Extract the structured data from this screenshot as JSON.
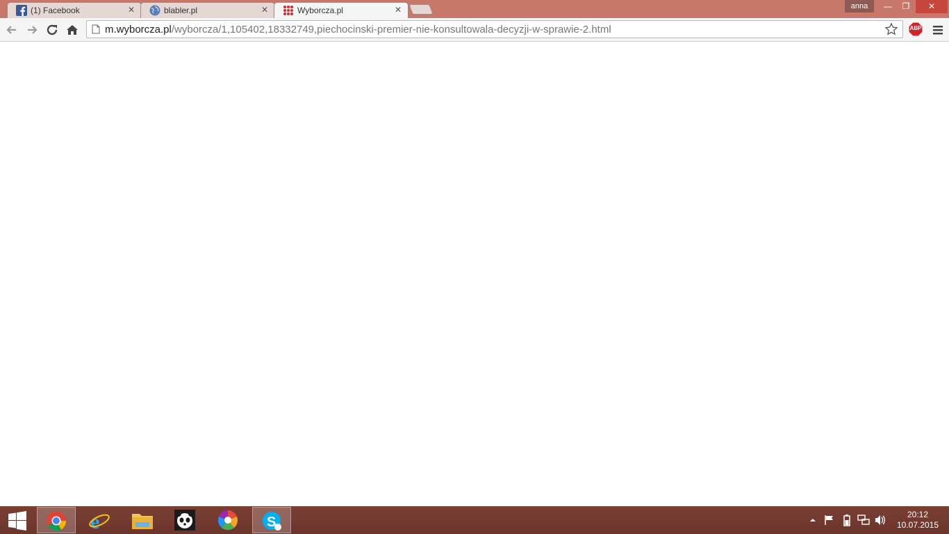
{
  "browser": {
    "tabs": [
      {
        "title": "(1) Facebook",
        "icon": "facebook-icon"
      },
      {
        "title": "blabler.pl",
        "icon": "globe-icon"
      },
      {
        "title": "Wyborcza.pl",
        "icon": "wyborcza-icon",
        "active": true
      }
    ],
    "profile_name": "anna",
    "address_bar": {
      "host": "m.wyborcza.pl",
      "path": "/wyborcza/1,105402,18332749,piechocinski-premier-nie-konsultowala-decyzji-w-sprawie-2.html"
    },
    "extension_badge": "ABP"
  },
  "taskbar": {
    "apps": [
      "windows-start-icon",
      "chrome-icon",
      "internet-explorer-icon",
      "file-explorer-icon",
      "panda-icon",
      "picasa-icon",
      "skype-icon"
    ],
    "clock": {
      "time": "20:12",
      "date": "10.07.2015"
    }
  },
  "colors": {
    "titlebar": "#c8786a",
    "taskbar": "#7a3f33",
    "close_button": "#c7463d"
  }
}
